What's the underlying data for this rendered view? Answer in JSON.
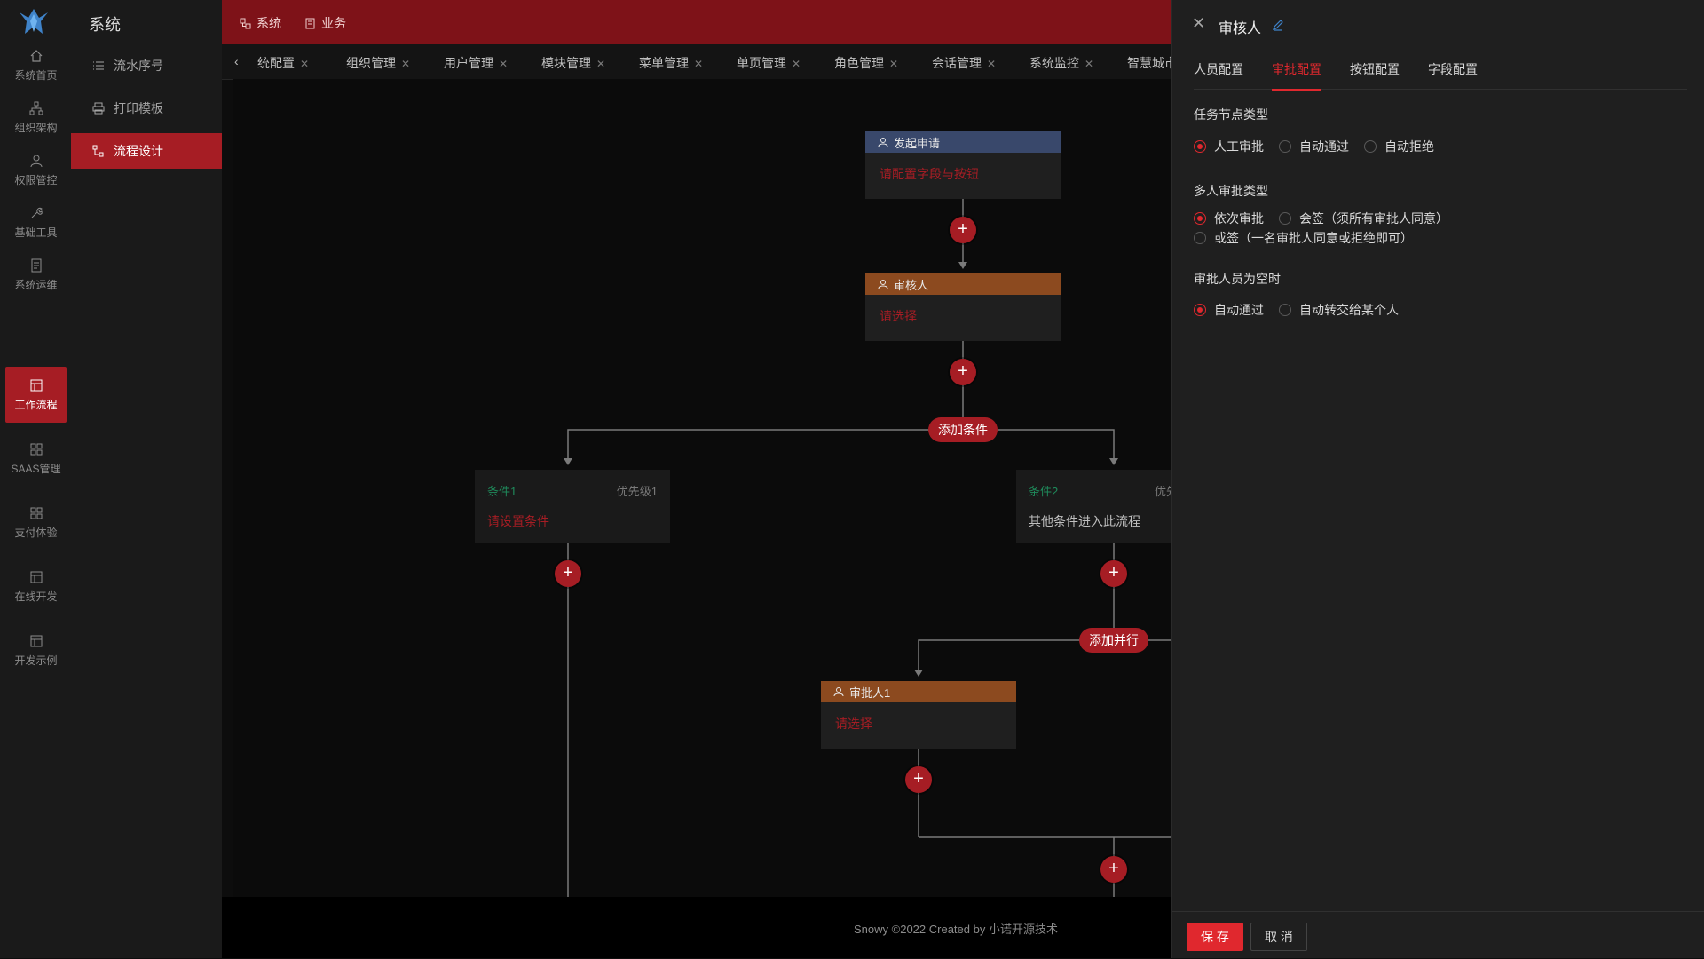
{
  "app": {
    "section_title": "系统"
  },
  "rail": {
    "items": [
      {
        "label": "系统首页",
        "icon": "home-icon"
      },
      {
        "label": "组织架构",
        "icon": "org-icon"
      },
      {
        "label": "权限管控",
        "icon": "user-icon"
      },
      {
        "label": "基础工具",
        "icon": "tool-icon"
      },
      {
        "label": "系统运维",
        "icon": "file-icon"
      },
      {
        "label": "工作流程",
        "icon": "layout-icon"
      },
      {
        "label": "SAAS管理",
        "icon": "grid-icon"
      },
      {
        "label": "支付体验",
        "icon": "grid-icon"
      },
      {
        "label": "在线开发",
        "icon": "layout-icon"
      },
      {
        "label": "开发示例",
        "icon": "layout-icon"
      }
    ]
  },
  "submenu": {
    "items": [
      {
        "label": "流水序号",
        "icon": "list-icon"
      },
      {
        "label": "打印模板",
        "icon": "printer-icon"
      },
      {
        "label": "流程设计",
        "icon": "flow-icon"
      }
    ]
  },
  "top_nav": {
    "items": [
      {
        "label": "系统",
        "icon": "cluster-icon"
      },
      {
        "label": "业务",
        "icon": "document-icon"
      }
    ]
  },
  "tabs": [
    "统配置",
    "组织管理",
    "用户管理",
    "模块管理",
    "菜单管理",
    "单页管理",
    "角色管理",
    "会话管理",
    "系统监控",
    "智慧城市"
  ],
  "flow": {
    "start_node": {
      "title": "发起申请",
      "body": "请配置字段与按钮"
    },
    "approver_node": {
      "title": "审核人",
      "body": "请选择"
    },
    "add_condition": "添加条件",
    "cond1": {
      "title": "条件1",
      "priority": "优先级1",
      "body": "请设置条件"
    },
    "cond2": {
      "title": "条件2",
      "priority": "优先",
      "body": "其他条件进入此流程"
    },
    "add_parallel": "添加并行",
    "approver1_node": {
      "title": "审批人1",
      "body": "请选择"
    }
  },
  "footer": {
    "text": "Snowy ©2022 Created by 小诺开源技术"
  },
  "drawer": {
    "title": "审核人",
    "tabs": [
      "人员配置",
      "审批配置",
      "按钮配置",
      "字段配置"
    ],
    "task_type": {
      "label": "任务节点类型",
      "options": [
        "人工审批",
        "自动通过",
        "自动拒绝"
      ],
      "selected": "人工审批"
    },
    "multi_type": {
      "label": "多人审批类型",
      "options": [
        "依次审批",
        "会签（须所有审批人同意）",
        "或签（一名审批人同意或拒绝即可）"
      ],
      "selected": "依次审批"
    },
    "empty_type": {
      "label": "审批人员为空时",
      "options": [
        "自动通过",
        "自动转交给某个人"
      ],
      "selected": "自动通过"
    },
    "save_label": "保 存",
    "cancel_label": "取 消"
  },
  "colors": {
    "accent": "#a61d24",
    "accent_bright": "#e0282e",
    "start_header": "#39486b",
    "approver_header": "#8c4a1f",
    "condition_title": "#1f8a5b"
  }
}
